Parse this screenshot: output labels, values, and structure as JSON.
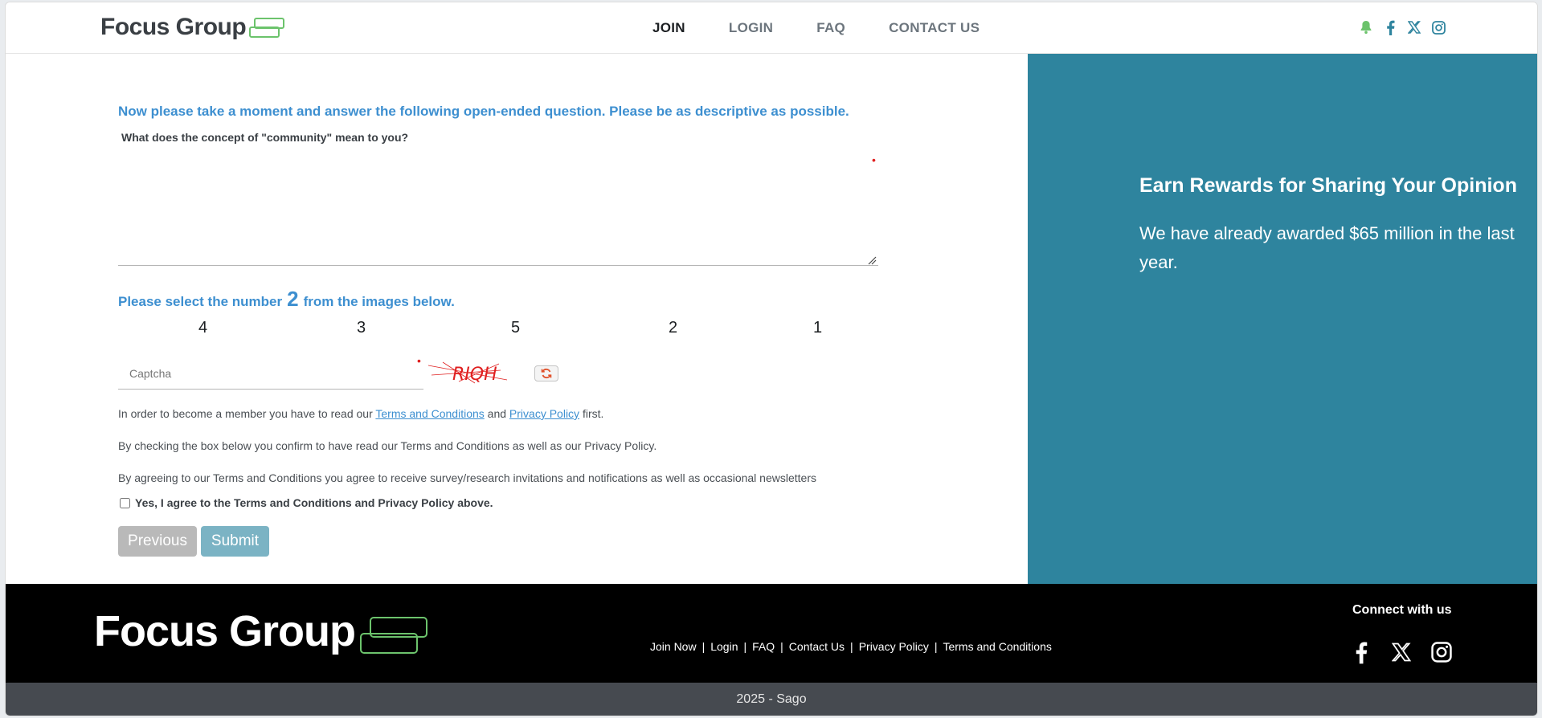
{
  "header": {
    "logo": "Focus Group",
    "nav": [
      {
        "label": "JOIN",
        "active": true
      },
      {
        "label": "LOGIN",
        "active": false
      },
      {
        "label": "FAQ",
        "active": false
      },
      {
        "label": "CONTACT US",
        "active": false
      }
    ],
    "social_icons": [
      "bell-icon",
      "facebook-icon",
      "x-icon",
      "instagram-icon"
    ]
  },
  "form": {
    "heading": "Now please take a moment and answer the following open-ended question. Please be as descriptive as possible.",
    "question": "What does the concept of \"community\" mean to you?",
    "answer_value": "",
    "select_prefix": "Please select the number",
    "select_number": "2",
    "select_suffix": "from the images below.",
    "number_options": [
      "4",
      "3",
      "5",
      "2",
      "1"
    ],
    "captcha_placeholder": "Captcha",
    "captcha_text": "RIQH",
    "terms_para_prefix": "In order to become a member you have to read our",
    "terms_link": "Terms and Conditions",
    "terms_and": "and",
    "privacy_link": "Privacy Policy",
    "terms_para_suffix": "first.",
    "confirm_para": "By checking the box below you confirm to have read our Terms and Conditions as well as our Privacy Policy.",
    "agree_para": "By agreeing to our Terms and Conditions you agree to receive survey/research invitations and notifications as well as occasional newsletters",
    "agree_checkbox_label": "Yes, I agree to the Terms and Conditions and Privacy Policy above.",
    "agree_checked": false,
    "previous_label": "Previous",
    "submit_label": "Submit"
  },
  "promo": {
    "title": "Earn Rewards for Sharing Your Opinion",
    "text": "We have already awarded $65 million in the last year."
  },
  "footer": {
    "logo": "Focus Group",
    "links": [
      "Join Now",
      "Login",
      "FAQ",
      "Contact Us",
      "Privacy Policy",
      "Terms and Conditions"
    ],
    "connect_label": "Connect with us",
    "social_icons": [
      "facebook-icon",
      "x-icon",
      "instagram-icon"
    ],
    "copyright": "2025 - Sago"
  },
  "colors": {
    "accent_blue": "#3d8fd0",
    "promo_bg": "#2e849e",
    "logo_green": "#6cc36c",
    "submit_bg": "#7bb3c4",
    "previous_bg": "#b9b9b9",
    "footer_bg": "#000000",
    "copyright_bg": "#464a50"
  }
}
